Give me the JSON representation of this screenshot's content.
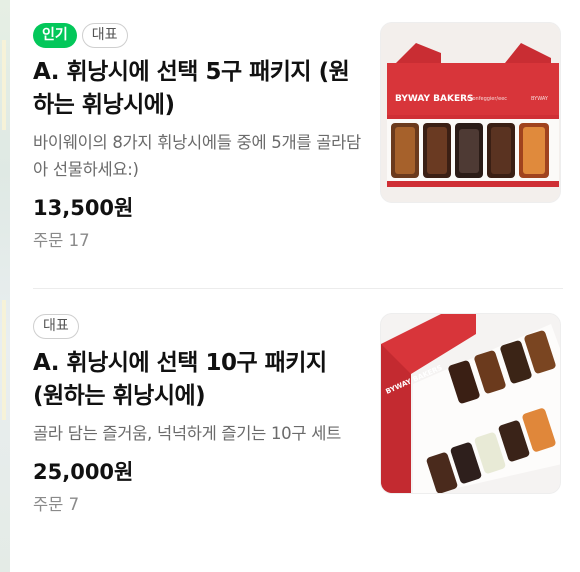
{
  "products": [
    {
      "badges": [
        "인기",
        "대표"
      ],
      "title": "A. 휘낭시에 선택 5구 패키지 (원하는 휘낭시에)",
      "description": "바이웨이의 8가지 휘낭시에들 중에 5개를 골라담아 선물하세요:)",
      "price": "13,500원",
      "orders": "주문 17",
      "image_brand_text": "BYWAY BAKERS"
    },
    {
      "badges": [
        "대표"
      ],
      "title": "A. 휘낭시에 선택 10구 패키지 (원하는 휘낭시에)",
      "description": "골라 담는 즐거움, 넉넉하게 즐기는 10구 세트",
      "price": "25,000원",
      "orders": "주문 7",
      "image_brand_text": "BYWAY BAKERS"
    }
  ],
  "colors": {
    "popular_badge": "#03c75a",
    "box_red": "#d8353a"
  },
  "icons": [
    "product-photo-5-pack",
    "product-photo-10-pack"
  ]
}
